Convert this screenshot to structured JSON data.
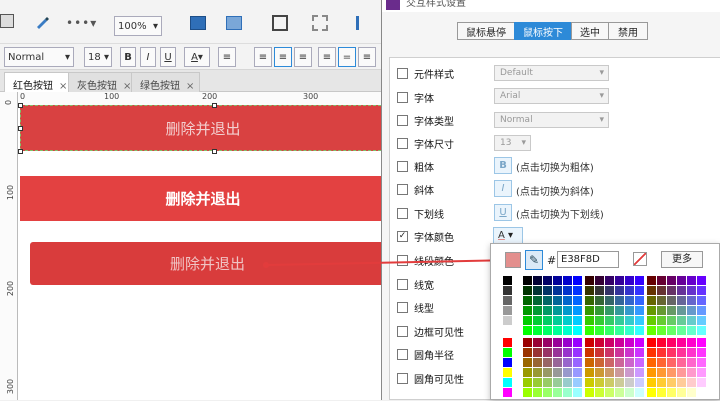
{
  "toolbar": {
    "zoom": "100%",
    "font_name": "Normal",
    "font_size": "18",
    "bold": "B",
    "italic": "I",
    "underline": "U",
    "font_color_letter": "A"
  },
  "tabs": [
    {
      "label": "红色按钮",
      "close": "×"
    },
    {
      "label": "灰色按钮",
      "close": "×"
    },
    {
      "label": "绿色按钮",
      "close": "×"
    }
  ],
  "ruler": {
    "h": [
      "0",
      "100",
      "200",
      "300"
    ],
    "v": [
      "0",
      "100",
      "200",
      "300"
    ]
  },
  "canvas": {
    "btn1": "删除并退出",
    "btn2": "删除并退出",
    "btn3": "删除并退出"
  },
  "dialog": {
    "title": "交互样式设置",
    "tabs": [
      "鼠标悬停",
      "鼠标按下",
      "选中",
      "禁用"
    ],
    "active_tab": 1,
    "rows": [
      {
        "label": "元件样式",
        "checked": false
      },
      {
        "label": "字体",
        "checked": false
      },
      {
        "label": "字体类型",
        "checked": false
      },
      {
        "label": "字体尺寸",
        "checked": false
      },
      {
        "label": "粗体",
        "checked": false
      },
      {
        "label": "斜体",
        "checked": false
      },
      {
        "label": "下划线",
        "checked": false
      },
      {
        "label": "字体颜色",
        "checked": true
      },
      {
        "label": "线段颜色",
        "checked": false
      },
      {
        "label": "线宽",
        "checked": false
      },
      {
        "label": "线型",
        "checked": false
      },
      {
        "label": "边框可见性",
        "checked": false
      },
      {
        "label": "圆角半径",
        "checked": false
      },
      {
        "label": "圆角可见性",
        "checked": false
      }
    ],
    "selects": {
      "style": "Default",
      "font": "Arial",
      "font_type": "Normal",
      "font_size": "13"
    },
    "toggles": {
      "bold": {
        "icon": "B",
        "hint": "(点击切换为粗体)"
      },
      "italic": {
        "icon": "I",
        "hint": "(点击切换为斜体)"
      },
      "underline": {
        "icon": "U",
        "hint": "(点击切换为下划线)"
      }
    },
    "font_color_letter": "A",
    "check_mark": "✓"
  },
  "color_picker": {
    "hash": "#",
    "hex": "E38F8D",
    "more": "更多",
    "current_color": "#E38F8D",
    "accent": "#2d8ad8"
  }
}
